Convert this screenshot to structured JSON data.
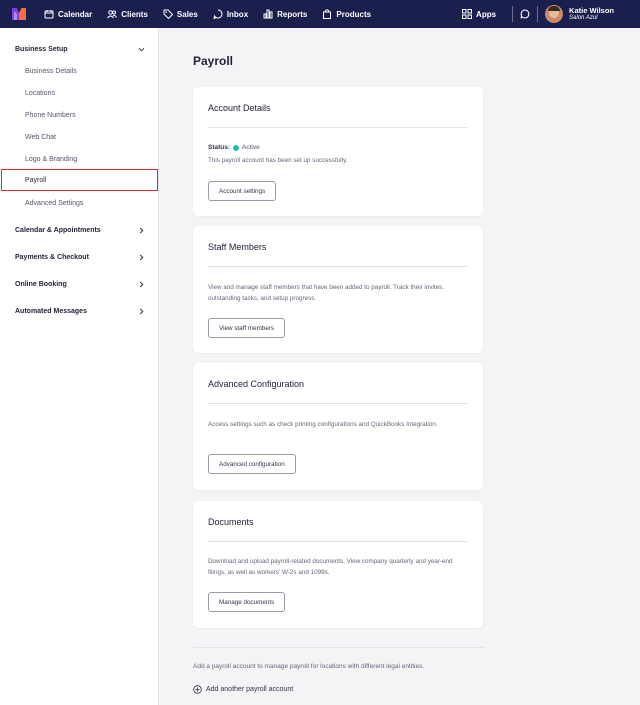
{
  "nav": {
    "items": [
      {
        "label": "Calendar",
        "icon": "calendar-icon"
      },
      {
        "label": "Clients",
        "icon": "clients-icon"
      },
      {
        "label": "Sales",
        "icon": "tag-icon"
      },
      {
        "label": "Inbox",
        "icon": "inbox-icon"
      },
      {
        "label": "Reports",
        "icon": "bar-chart-icon"
      },
      {
        "label": "Products",
        "icon": "bag-icon"
      }
    ],
    "apps_label": "Apps",
    "user": {
      "name": "Katie Wilson",
      "org": "Salon Azul"
    },
    "colors": {
      "bar": "#1b1f4e",
      "logo_purple": "#7b3fe4",
      "logo_orange": "#ff6a3d"
    }
  },
  "sidebar": {
    "section_title": "Business Setup",
    "items": [
      {
        "label": "Business Details"
      },
      {
        "label": "Locations"
      },
      {
        "label": "Phone Numbers"
      },
      {
        "label": "Web Chat"
      },
      {
        "label": "Logo & Branding"
      },
      {
        "label": "Payroll",
        "active": true
      },
      {
        "label": "Advanced Settings"
      }
    ],
    "sections": [
      {
        "label": "Calendar & Appointments"
      },
      {
        "label": "Payments & Checkout"
      },
      {
        "label": "Online Booking"
      },
      {
        "label": "Automated Messages"
      }
    ]
  },
  "main": {
    "title": "Payroll",
    "cards": [
      {
        "title": "Account Details",
        "status_label": "Status:",
        "status_value": "Active",
        "text": "This payroll account has been set up successfully.",
        "button": "Account settings"
      },
      {
        "title": "Staff Members",
        "text": "View and manage staff members that have been added to payroll. Track their invites, outstanding tasks, and setup progress.",
        "button": "View staff members"
      },
      {
        "title": "Advanced Configuration",
        "text": "Access settings such as check printing configurations and QuickBooks Integration.",
        "button": "Advanced configuration"
      },
      {
        "title": "Documents",
        "text": "Download and upload payroll-related documents. View company quarterly and year-end filings, as well as workers' W-2s and 1099s.",
        "button": "Manage documents"
      }
    ],
    "footer_text": "Add a payroll account to manage payroll for locations with different legal entities.",
    "add_link": "Add another payroll account",
    "status_color": "#1fbfa8",
    "highlight_color": "#e02b2b"
  }
}
